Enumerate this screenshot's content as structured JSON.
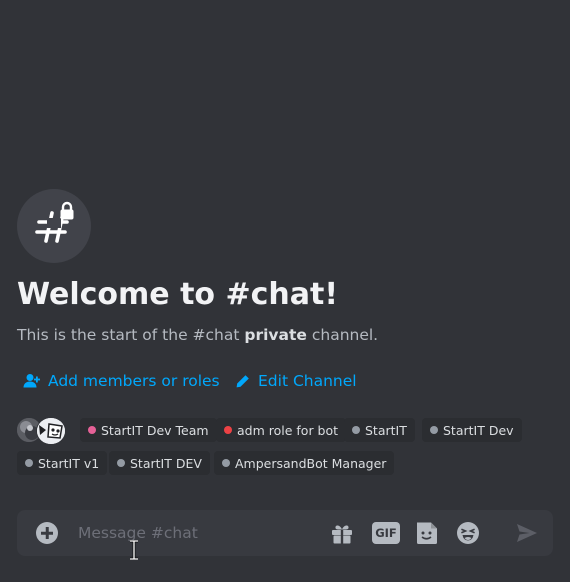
{
  "welcome": {
    "title": "Welcome to #chat!",
    "subtitle_prefix": "This is the start of the #chat ",
    "subtitle_bold": "private",
    "subtitle_suffix": " channel."
  },
  "actions": {
    "add_members_label": "Add members or roles",
    "edit_channel_label": "Edit Channel"
  },
  "roles": [
    {
      "name": "StartIT Dev Team",
      "color": "#e56197"
    },
    {
      "name": "adm role for bot",
      "color": "#ed4245"
    },
    {
      "name": "StartIT",
      "color": "#949ba4"
    },
    {
      "name": "StartIT Dev",
      "color": "#949ba4"
    },
    {
      "name": "StartIT v1",
      "color": "#949ba4"
    },
    {
      "name": "StartIT DEV",
      "color": "#949ba4"
    },
    {
      "name": "AmpersandBot Manager",
      "color": "#949ba4"
    }
  ],
  "composer": {
    "placeholder": "Message #chat",
    "gif_label": "GIF"
  },
  "colors": {
    "background": "#313338",
    "link": "#00a8fc",
    "chip_background": "#2b2d31",
    "composer_background": "#383a40"
  },
  "icons": {
    "channel": "hash-lock-icon",
    "add_members": "person-add-icon",
    "edit": "pencil-icon",
    "attach": "plus-circle-icon",
    "gift": "gift-icon",
    "gif": "gif-icon",
    "sticker": "sticker-icon",
    "emoji": "emoji-icon",
    "send": "send-icon"
  }
}
